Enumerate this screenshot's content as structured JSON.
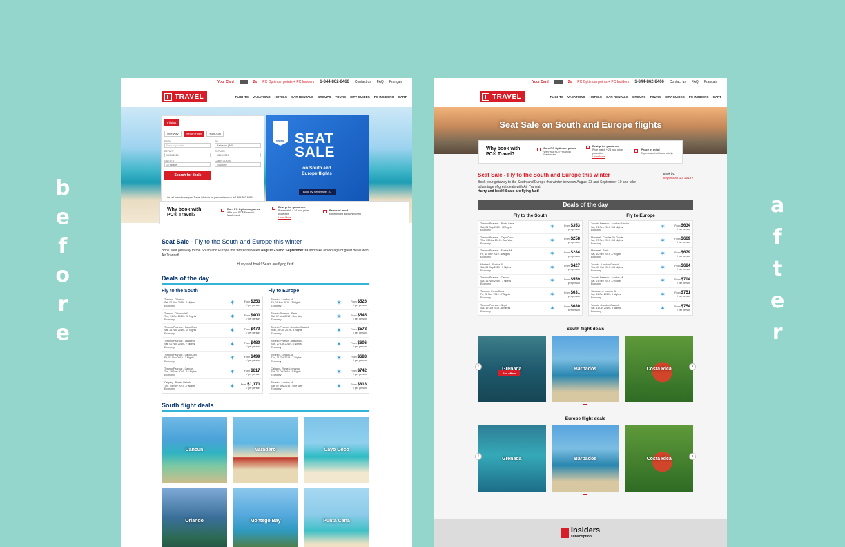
{
  "labels": {
    "before": [
      "b",
      "e",
      "f",
      "o",
      "r",
      "e"
    ],
    "after": [
      "a",
      "f",
      "t",
      "e",
      "r"
    ]
  },
  "header": {
    "your_card": "Your Card",
    "points": "2x",
    "points_text": "PC Optimum points + PC Insiders",
    "phone": "1-844-862-8466",
    "phone_after": "1-844-862-8466",
    "contact": "Contact us",
    "faq": "FAQ",
    "lang": "Français",
    "logo": "TRAVEL",
    "nav": [
      "FLIGHTS",
      "VACATIONS",
      "HOTELS",
      "CAR RENTALS",
      "GROUPS",
      "TOURS",
      "CITY GUIDES",
      "PC INSIDERS",
      "CART"
    ]
  },
  "before": {
    "booking": {
      "tab": "Flights",
      "trip_types": [
        "One Way",
        "Return Flight",
        "Multi-City"
      ],
      "from_label": "FROM",
      "from_placeholder": "Enter city / origin",
      "to_label": "TO",
      "to_value": "Barbados (BGI)",
      "depart_label": "DEPART",
      "depart_value": "10/09/2019",
      "return_label": "RETURN",
      "return_value": "13/10/2019",
      "guests_label": "GUESTS",
      "guests_value": "1 Traveller",
      "cabin_label": "CABIN CLASS",
      "cabin_value": "Economy",
      "search": "Search for deals",
      "advisor": "Or call one of our expert Travel Advisors for personal service at 1-844-862-8466"
    },
    "promo": {
      "badge": "transat",
      "line1": "SEAT",
      "line2": "SALE",
      "sub": "on South and Europe flights",
      "cta": "Book by September 10"
    },
    "why": {
      "title": "Why book with PC® Travel?",
      "items": [
        {
          "title": "Earn PC Optimum points",
          "text": "With your PC® Financial Mastercard"
        },
        {
          "title": "Best price guarantee",
          "text": "Price match + 24 hour price protection",
          "link": "Learn More"
        },
        {
          "title": "Peace of mind",
          "text": "Experienced advisors to help"
        }
      ]
    },
    "seat_title": "Seat Sale -",
    "seat_sub": " Fly to the South and Europe this winter",
    "intro_pre": "Book your getaway to the South and Europe this winter between ",
    "intro_dates": "August 23 and September 10",
    "intro_post": " and take advantage of great deals with Air Transat!",
    "hurry": "Hurry and book! Seats are flying fast!",
    "deals_title": "Deals of the day",
    "south_title": "Fly to the South",
    "europe_title": "Fly to Europe",
    "south": [
      {
        "route": "Toronto - Orlando",
        "date": "Sat, 02 Nov 2019 - 7 Nights",
        "cls": "Economy",
        "price": "$353"
      },
      {
        "route": "Toronto - Orlando Int'l",
        "date": "Thu, 31 Oct 2019 - 28 Nights",
        "cls": "Economy",
        "price": "$400"
      },
      {
        "route": "Toronto Pearson - Cayo Coco",
        "date": "Sat, 21 Nov 2019 - 14 Nights",
        "cls": "Economy",
        "price": "$479"
      },
      {
        "route": "Toronto Pearson - Varadero",
        "date": "Sat, 02 Nov 2019 - 7 Nights",
        "cls": "Economy",
        "price": "$489"
      },
      {
        "route": "Toronto Pearson - Cayo Coco",
        "date": "Fri, 01 Nov 2019 - 7 Nights",
        "cls": "Economy",
        "price": "$499"
      },
      {
        "route": "Toronto Pearson - Cancun",
        "date": "Tue, 16 Nov 2019 - 14 Nights",
        "cls": "Economy",
        "price": "$617"
      },
      {
        "route": "Calgary - Puerto Vallarta",
        "date": "Thu, 05 Nov 2019 - 7 Nights",
        "cls": "Economy",
        "price": "$1,170"
      }
    ],
    "europe": [
      {
        "route": "Toronto - London All",
        "date": "Fri, 01 Nov 2019 - 3 Nights",
        "cls": "Economy",
        "price": "$526"
      },
      {
        "route": "Toronto Pearson - Paris",
        "date": "Sat, 02 Nov 2019 - One Way",
        "cls": "Economy",
        "price": "$545"
      },
      {
        "route": "Toronto Pearson - London Gatwick",
        "date": "Mon, 28 Oct 2019 - 8 Nights",
        "cls": "Economy",
        "price": "$578"
      },
      {
        "route": "Toronto Pearson - Barcelona",
        "date": "Sun, 27 Oct 2019 - 8 Nights",
        "cls": "Economy",
        "price": "$606"
      },
      {
        "route": "Toronto - London All",
        "date": "Thu, 31 Oct 2019 - 7 Nights",
        "cls": "Economy",
        "price": "$683"
      },
      {
        "route": "Calgary - Rome Leonardo",
        "date": "Sat, 26 Oct 2019 - 9 Nights",
        "cls": "Economy",
        "price": "$742"
      },
      {
        "route": "Toronto - London All",
        "date": "Sat, 02 Nov 2019 - One Way",
        "cls": "Economy",
        "price": "$818"
      }
    ],
    "south_deals_title": "South flight deals",
    "tiles": [
      "Cancun",
      "Varadero",
      "Cayo Coco",
      "Orlando",
      "Montego Bay",
      "Punta Cana"
    ],
    "prices_label": "From",
    "per_person": "/ per person",
    "airline": "transat"
  },
  "after": {
    "hero_title": "Seat Sale on South and Europe flights",
    "why": {
      "title": "Why book with PC® Travel?",
      "items": [
        {
          "title": "Earn PC Optimum points",
          "text": "With your PC® Financial Mastercard"
        },
        {
          "title": "Best price guarantee",
          "text": "Price match + 24 hour price protection",
          "link": "Learn More"
        },
        {
          "title": "Peace of mind",
          "text": "Experienced advisors to help"
        }
      ]
    },
    "seat_title": "Seat Sale - Fly to the South and Europe this winter",
    "intro": "Book your getaway to the South and Europe this winter between August 23 and September 10 and take advantage of great deals with Air Transat!",
    "hurry": "Hurry and book! Seats are flying fast!",
    "book_by": "Book by:",
    "book_by_date": "September 10, 2019",
    "deals_title": "Deals of the day",
    "south_title": "Fly to the South",
    "europe_title": "Fly to Europe",
    "south": [
      {
        "route": "Toronto Pearson - Punta Cana",
        "date": "Sat, 21 Sep 2019 - 12 Nights",
        "cls": "Economy",
        "price": "$353"
      },
      {
        "route": "Toronto Pearson - Cayo Coco",
        "date": "Thu, 03 Nov 2019 - One Way",
        "cls": "Economy",
        "price": "$258"
      },
      {
        "route": "Toronto Pearson - Florida All",
        "date": "Fri, 15 Nov 2019 - 8 Nights",
        "cls": "Economy",
        "price": "$284"
      },
      {
        "route": "Montreal - Florida All",
        "date": "Sat, 21 Sep 2019 - 7 Nights",
        "cls": "Economy",
        "price": "$427"
      },
      {
        "route": "Toronto Pearson - Cancun",
        "date": "Sat, 16 Nov 2019 - 7 Nights",
        "cls": "Economy",
        "price": "$559"
      },
      {
        "route": "Toronto - Punta Cana",
        "date": "Fri, 22 Nov 2019 - 7 Nights",
        "cls": "Economy",
        "price": "$631"
      },
      {
        "route": "Toronto Pearson - Negril",
        "date": "Sat, 19 Oct 2019 - 8 Nights",
        "cls": "Economy",
        "price": "$680"
      }
    ],
    "europe": [
      {
        "route": "Toronto Pearson - London Gatwick",
        "date": "Sat, 21 Sep 2019 - 14 Nights",
        "cls": "Economy",
        "price": "$634"
      },
      {
        "route": "Montreal - Charles De Gaulle",
        "date": "Sat, 07 Sep 2019 - 14 Nights",
        "cls": "Economy",
        "price": "$669"
      },
      {
        "route": "Montreal - Paris",
        "date": "Sat, 10 Sep 2019 - 7 Nights",
        "cls": "Economy",
        "price": "$679"
      },
      {
        "route": "Toronto - London Gatwick",
        "date": "Thu, 03 Oct 2019 - 14 Nights",
        "cls": "Economy",
        "price": "$684"
      },
      {
        "route": "Toronto Pearson - London All",
        "date": "Sat, 21 Sep 2019 - 7 Nights",
        "cls": "Economy",
        "price": "$704"
      },
      {
        "route": "Vancouver - London All",
        "date": "Sat, 11 Oct 2019 - 8 Nights",
        "cls": "Economy",
        "price": "$751"
      },
      {
        "route": "Toronto - London Gatwick",
        "date": "Sat, 11 Oct 2019 - 8 Nights",
        "cls": "Economy",
        "price": "$754"
      }
    ],
    "south_deals_title": "South flight deals",
    "south_tiles": [
      "Grenada",
      "Barbados",
      "Costa Rica"
    ],
    "see_offers": "See offers",
    "europe_deals_title": "Europe flight deals",
    "europe_tiles": [
      "Grenada",
      "Barbados",
      "Costa Rica"
    ],
    "insiders": "insiders",
    "subscription": "subscription",
    "tile_corner_label": "Grenada"
  },
  "colors": {
    "accent": "#d71e28",
    "navy": "#0a3870",
    "background": "#94d6cc",
    "rule": "#33b5d9"
  }
}
